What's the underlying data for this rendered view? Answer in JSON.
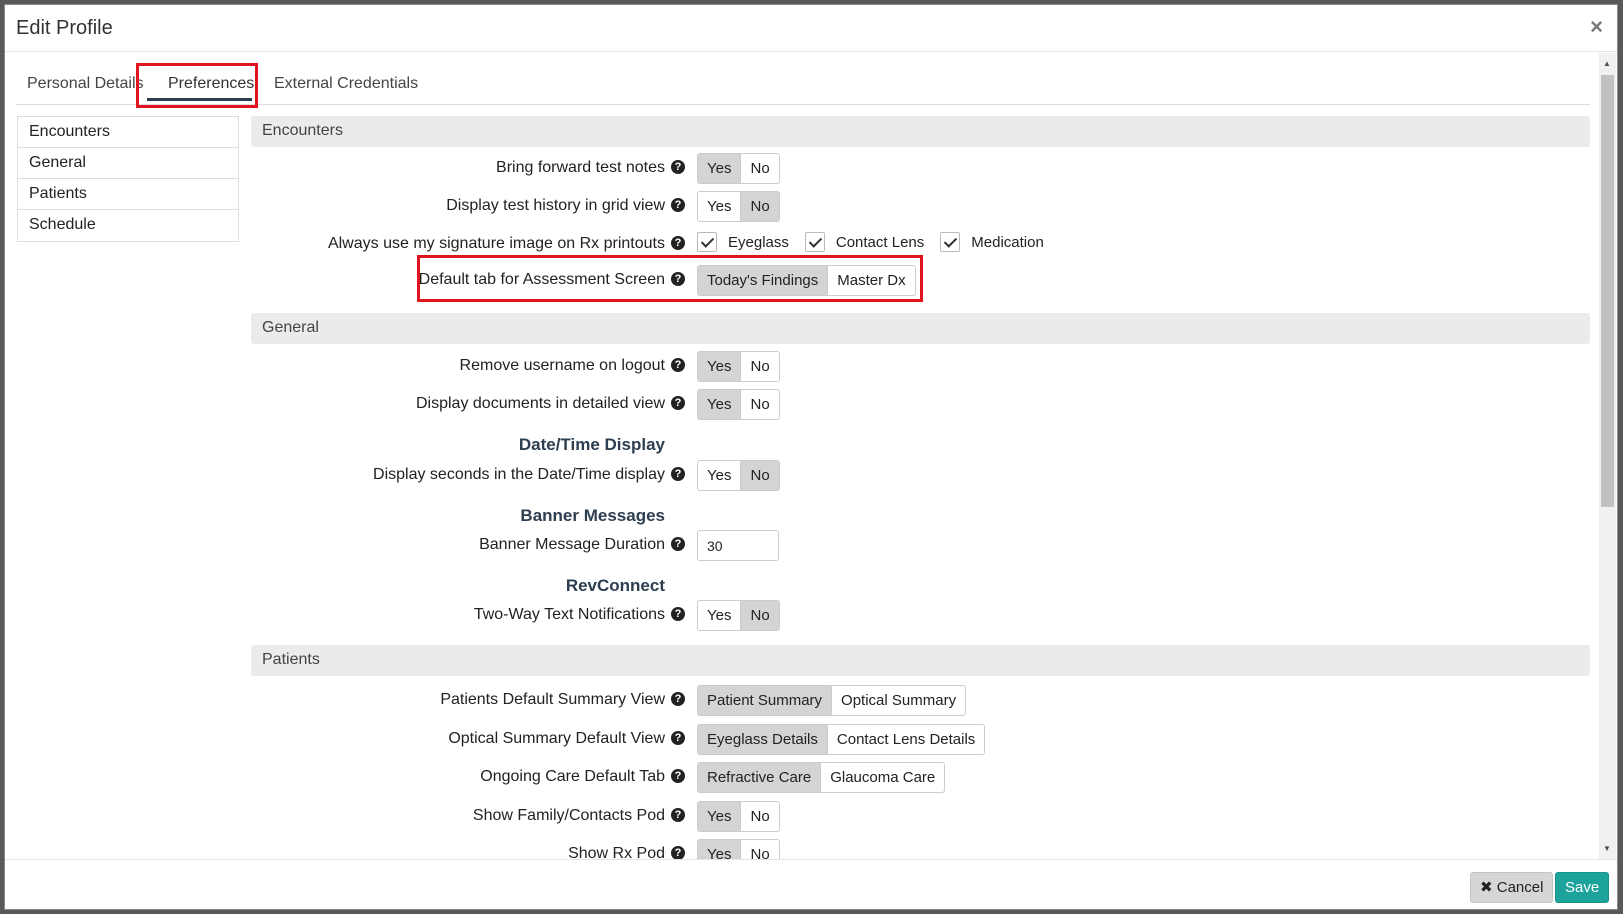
{
  "modal": {
    "title": "Edit Profile",
    "close_glyph": "×"
  },
  "tabs": [
    {
      "label": "Personal Details"
    },
    {
      "label": "Preferences"
    },
    {
      "label": "External Credentials"
    }
  ],
  "sidebar": {
    "items": [
      {
        "label": "Encounters"
      },
      {
        "label": "General"
      },
      {
        "label": "Patients"
      },
      {
        "label": "Schedule"
      }
    ]
  },
  "help_glyph": "?",
  "sections": {
    "encounters": {
      "title": "Encounters",
      "bring_forward": {
        "label": "Bring forward test notes",
        "options": [
          "Yes",
          "No"
        ],
        "selected": "Yes"
      },
      "grid_view": {
        "label": "Display test history in grid view",
        "options": [
          "Yes",
          "No"
        ],
        "selected": "No"
      },
      "signature": {
        "label": "Always use my signature image on Rx printouts",
        "checks": [
          "Eyeglass",
          "Contact Lens",
          "Medication"
        ]
      },
      "default_tab": {
        "label": "Default tab for Assessment Screen",
        "options": [
          "Today's Findings",
          "Master Dx"
        ],
        "selected": "Today's Findings"
      }
    },
    "general": {
      "title": "General",
      "remove_username": {
        "label": "Remove username on logout",
        "options": [
          "Yes",
          "No"
        ],
        "selected": "Yes"
      },
      "docs_detailed": {
        "label": "Display documents in detailed view",
        "options": [
          "Yes",
          "No"
        ],
        "selected": "Yes"
      },
      "datetime_heading": "Date/Time Display",
      "seconds": {
        "label": "Display seconds in the Date/Time display",
        "options": [
          "Yes",
          "No"
        ],
        "selected": "No"
      },
      "banner_heading": "Banner Messages",
      "banner_duration": {
        "label": "Banner Message Duration",
        "value": "30"
      },
      "revconnect_heading": "RevConnect",
      "two_way": {
        "label": "Two-Way Text Notifications",
        "options": [
          "Yes",
          "No"
        ],
        "selected": "No"
      }
    },
    "patients": {
      "title": "Patients",
      "summary_view": {
        "label": "Patients Default Summary View",
        "options": [
          "Patient Summary",
          "Optical Summary"
        ],
        "selected": "Patient Summary"
      },
      "optical_view": {
        "label": "Optical Summary Default View",
        "options": [
          "Eyeglass Details",
          "Contact Lens Details"
        ],
        "selected": "Eyeglass Details"
      },
      "ongoing_care": {
        "label": "Ongoing Care Default Tab",
        "options": [
          "Refractive Care",
          "Glaucoma Care"
        ],
        "selected": "Refractive Care"
      },
      "family_pod": {
        "label": "Show Family/Contacts Pod",
        "options": [
          "Yes",
          "No"
        ],
        "selected": "Yes"
      },
      "rx_pod": {
        "label": "Show Rx Pod",
        "options": [
          "Yes",
          "No"
        ],
        "selected": "Yes"
      }
    }
  },
  "footer": {
    "cancel_label": "Cancel",
    "cancel_icon": "✖",
    "save_label": "Save"
  },
  "colors": {
    "accent": "#1ba39c",
    "highlight": "#e0141e",
    "heading": "#2d3e50"
  }
}
